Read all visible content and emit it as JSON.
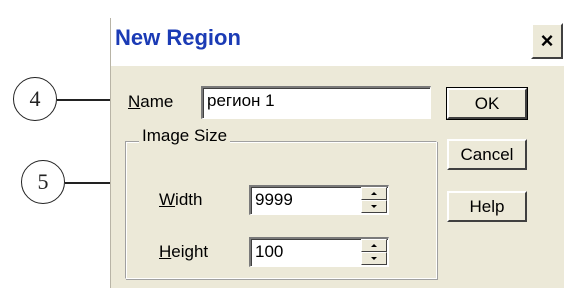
{
  "callouts": {
    "name": "4",
    "size": "5"
  },
  "dialog": {
    "title": "New Region",
    "close_label": "×",
    "name": {
      "label_underlined": "N",
      "label_rest": "ame",
      "value": "регион 1"
    },
    "image_size_group": {
      "title": "Image Size",
      "width": {
        "label_underlined": "W",
        "label_rest": "idth",
        "value": "9999"
      },
      "height": {
        "label_underlined": "H",
        "label_rest": "eight",
        "value": "100"
      }
    },
    "buttons": {
      "ok": "OK",
      "cancel": "Cancel",
      "help": "Help"
    }
  }
}
